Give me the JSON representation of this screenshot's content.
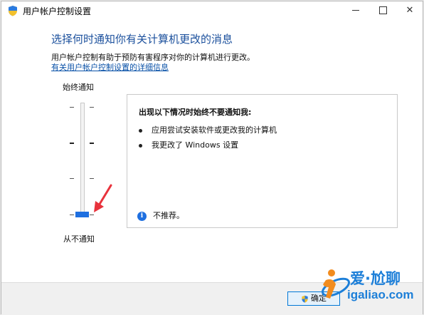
{
  "window": {
    "title": "用户帐户控制设置",
    "icon": "uac-shield-icon"
  },
  "titlebar_buttons": {
    "minimize_icon": "minimize-icon",
    "maximize_icon": "maximize-icon",
    "close_glyph": "✕"
  },
  "main": {
    "heading": "选择何时通知你有关计算机更改的消息",
    "description": "用户帐户控制有助于预防有害程序对你的计算机进行更改。",
    "link": "有关用户帐户控制设置的详细信息"
  },
  "slider": {
    "top_label": "始终通知",
    "bottom_label": "从不通知",
    "level_count": 4,
    "selected_level": 1,
    "accent": "#1e6fe0"
  },
  "panel": {
    "heading": "出现以下情况时始终不要通知我:",
    "bullets": [
      "应用尝试安装软件或更改我的计算机",
      "我更改了 Windows 设置"
    ],
    "info_glyph": "i",
    "info_text": "不推荐。"
  },
  "footer": {
    "ok_label": "确定"
  },
  "watermark": {
    "line1": "爱·尬聊",
    "line2": "igaliao.com"
  },
  "colors": {
    "heading": "#1a4f9c",
    "link": "#0a52a8",
    "watermark": "#1d7fd8",
    "arrow": "#e8323c"
  }
}
